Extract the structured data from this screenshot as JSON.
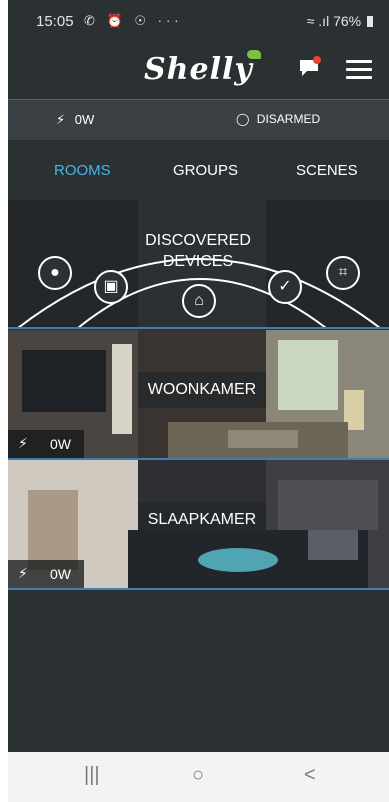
{
  "status_bar": {
    "time": "15:05",
    "notification_icons": "whatsapp-icon, alarm-icon, podcast-icon, more-icon",
    "more": "···",
    "battery": "76%"
  },
  "header": {
    "logo_text": "Shelly",
    "accent_color": "#45b6e8",
    "notification_dot_color": "#e8452c"
  },
  "summary": {
    "power": "0W",
    "security": "DISARMED"
  },
  "tabs": [
    {
      "label": "ROOMS",
      "active": true
    },
    {
      "label": "GROUPS",
      "active": false
    },
    {
      "label": "SCENES",
      "active": false
    }
  ],
  "discovered": {
    "title_line1": "DISCOVERED",
    "title_line2": "DEVICES"
  },
  "rooms": [
    {
      "name": "WOONKAMER",
      "power": "0W"
    },
    {
      "name": "SLAAPKAMER",
      "power": "0W"
    }
  ],
  "navbar": {
    "recent": "|||",
    "home": "○",
    "back": "<"
  }
}
